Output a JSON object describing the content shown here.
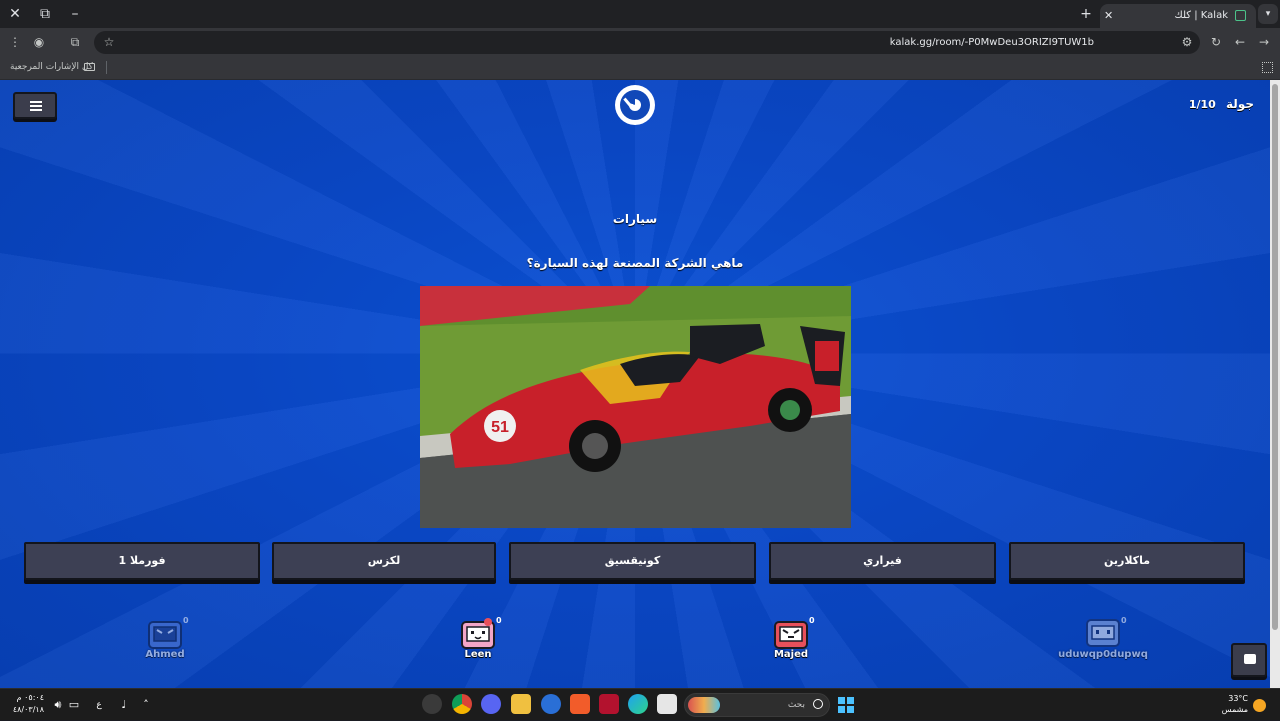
{
  "browser": {
    "tab_title": "Kalak | كلك",
    "url": "kalak.gg/room/-P0MwDeu3ORIZI9TUW1b",
    "bookmarks_all": "كل الإشارات المرجعية"
  },
  "game": {
    "round_label": "جولة",
    "round_value": "1/10",
    "category": "سيارات",
    "question": "ماهي الشركة المصنعة لهذه السيارة؟",
    "answers": [
      "ماكلارين",
      "فيراري",
      "كونيقسيق",
      "لكزس",
      "فورملا 1"
    ],
    "players": [
      {
        "name": "uduwqp0dupwq",
        "score": "0",
        "color": "#9fb6e6",
        "faded": true
      },
      {
        "name": "Majed",
        "score": "0",
        "color": "#e8505b",
        "faded": false
      },
      {
        "name": "Leen",
        "score": "0",
        "color": "#f3a6c8",
        "faded": false
      },
      {
        "name": "Ahmed",
        "score": "0",
        "color": "#5a7fd6",
        "faded": true
      }
    ]
  },
  "taskbar": {
    "search_placeholder": "بحث",
    "time": "٠٥:٠٤ م",
    "date": "٤٨/٠٣/١٨",
    "language": "ع",
    "temperature": "33°C",
    "weather": "مشمس"
  }
}
